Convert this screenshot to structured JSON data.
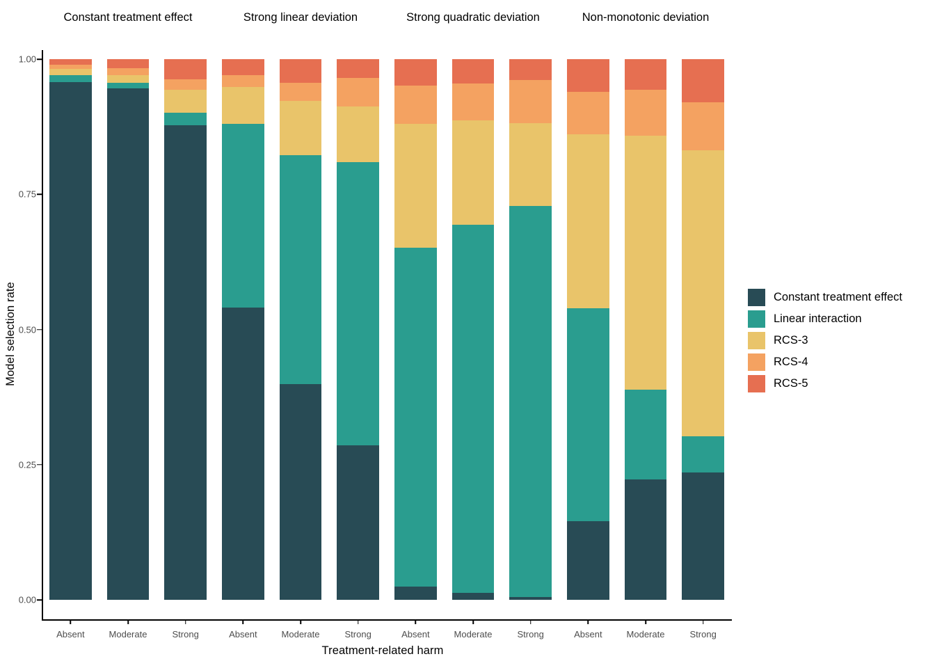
{
  "axes": {
    "y_title": "Model selection rate",
    "x_title": "Treatment-related harm",
    "y_ticks": [
      "0.00",
      "0.25",
      "0.50",
      "0.75",
      "1.00"
    ]
  },
  "legend": {
    "items": [
      {
        "label": "Constant treatment effect",
        "color": "#284B55"
      },
      {
        "label": "Linear interaction",
        "color": "#2A9D8F"
      },
      {
        "label": "RCS-3",
        "color": "#E9C46A"
      },
      {
        "label": "RCS-4",
        "color": "#F4A261"
      },
      {
        "label": "RCS-5",
        "color": "#E66F51"
      }
    ]
  },
  "chart_data": {
    "type": "bar",
    "subtype": "stacked-100-faceted",
    "title": "",
    "xlabel": "Treatment-related harm",
    "ylabel": "Model selection rate",
    "ylim": [
      0,
      1
    ],
    "ytick_values": [
      0.0,
      0.25,
      0.5,
      0.75,
      1.0
    ],
    "grid": false,
    "legend_position": "right",
    "categories": [
      "Absent",
      "Moderate",
      "Strong"
    ],
    "series_names": [
      "Constant treatment effect",
      "Linear interaction",
      "RCS-3",
      "RCS-4",
      "RCS-5"
    ],
    "series_colors": [
      "#284B55",
      "#2A9D8F",
      "#E9C46A",
      "#F4A261",
      "#E66F51"
    ],
    "facets": [
      {
        "title": "Constant treatment effect",
        "series": [
          {
            "name": "Constant treatment effect",
            "values": [
              0.957,
              0.946,
              0.878
            ]
          },
          {
            "name": "Linear interaction",
            "values": [
              0.013,
              0.01,
              0.023
            ]
          },
          {
            "name": "RCS-3",
            "values": [
              0.012,
              0.015,
              0.043
            ]
          },
          {
            "name": "RCS-4",
            "values": [
              0.008,
              0.012,
              0.019
            ]
          },
          {
            "name": "RCS-5",
            "values": [
              0.01,
              0.017,
              0.037
            ]
          }
        ]
      },
      {
        "title": "Strong linear deviation",
        "series": [
          {
            "name": "Constant treatment effect",
            "values": [
              0.54,
              0.399,
              0.286
            ]
          },
          {
            "name": "Linear interaction",
            "values": [
              0.34,
              0.424,
              0.524
            ]
          },
          {
            "name": "RCS-3",
            "values": [
              0.068,
              0.1,
              0.102
            ]
          },
          {
            "name": "RCS-4",
            "values": [
              0.023,
              0.033,
              0.053
            ]
          },
          {
            "name": "RCS-5",
            "values": [
              0.029,
              0.044,
              0.035
            ]
          }
        ]
      },
      {
        "title": "Strong quadratic deviation",
        "series": [
          {
            "name": "Constant treatment effect",
            "values": [
              0.025,
              0.013,
              0.005
            ]
          },
          {
            "name": "Linear interaction",
            "values": [
              0.626,
              0.681,
              0.724
            ]
          },
          {
            "name": "RCS-3",
            "values": [
              0.229,
              0.193,
              0.152
            ]
          },
          {
            "name": "RCS-4",
            "values": [
              0.071,
              0.068,
              0.081
            ]
          },
          {
            "name": "RCS-5",
            "values": [
              0.049,
              0.045,
              0.038
            ]
          }
        ]
      },
      {
        "title": "Non-monotonic deviation",
        "series": [
          {
            "name": "Constant treatment effect",
            "values": [
              0.145,
              0.223,
              0.236
            ]
          },
          {
            "name": "Linear interaction",
            "values": [
              0.394,
              0.166,
              0.066
            ]
          },
          {
            "name": "RCS-3",
            "values": [
              0.322,
              0.469,
              0.529
            ]
          },
          {
            "name": "RCS-4",
            "values": [
              0.079,
              0.085,
              0.089
            ]
          },
          {
            "name": "RCS-5",
            "values": [
              0.06,
              0.057,
              0.08
            ]
          }
        ]
      }
    ]
  }
}
